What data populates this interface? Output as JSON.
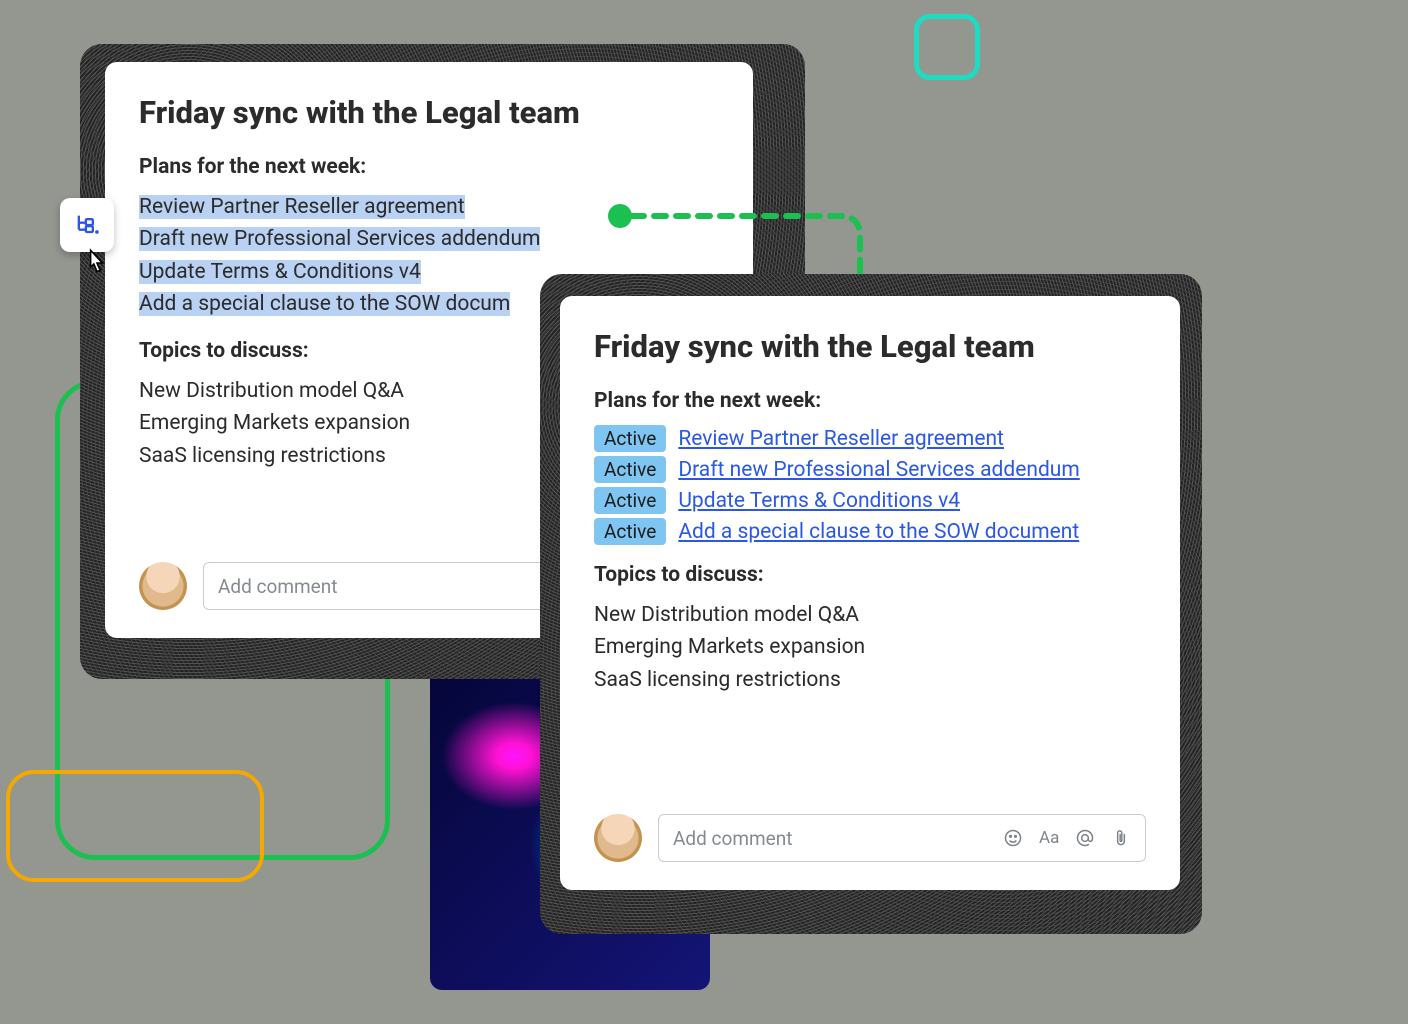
{
  "card1": {
    "title": "Friday sync with the Legal team",
    "plans_heading": "Plans for the next week:",
    "topics_heading": "Topics to discuss:",
    "plans": [
      "Review Partner Reseller agreement",
      "Draft new Professional Services addendum",
      "Update Terms & Conditions v4",
      "Add a special clause to the SOW docum"
    ],
    "topics": [
      "New Distribution model Q&A",
      "Emerging Markets expansion",
      "SaaS licensing restrictions"
    ],
    "comment_placeholder": "Add comment"
  },
  "card2": {
    "title": "Friday sync with the Legal team",
    "plans_heading": "Plans for the next week:",
    "topics_heading": "Topics to discuss:",
    "tasks": [
      {
        "status": "Active",
        "label": "Review Partner Reseller agreement"
      },
      {
        "status": "Active",
        "label": "Draft new Professional Services addendum"
      },
      {
        "status": "Active",
        "label": "Update Terms & Conditions v4"
      },
      {
        "status": "Active",
        "label": "Add a special clause to the SOW document"
      }
    ],
    "topics": [
      "New Distribution model Q&A",
      "Emerging Markets expansion",
      "SaaS licensing restrictions"
    ],
    "comment_placeholder": "Add comment"
  }
}
